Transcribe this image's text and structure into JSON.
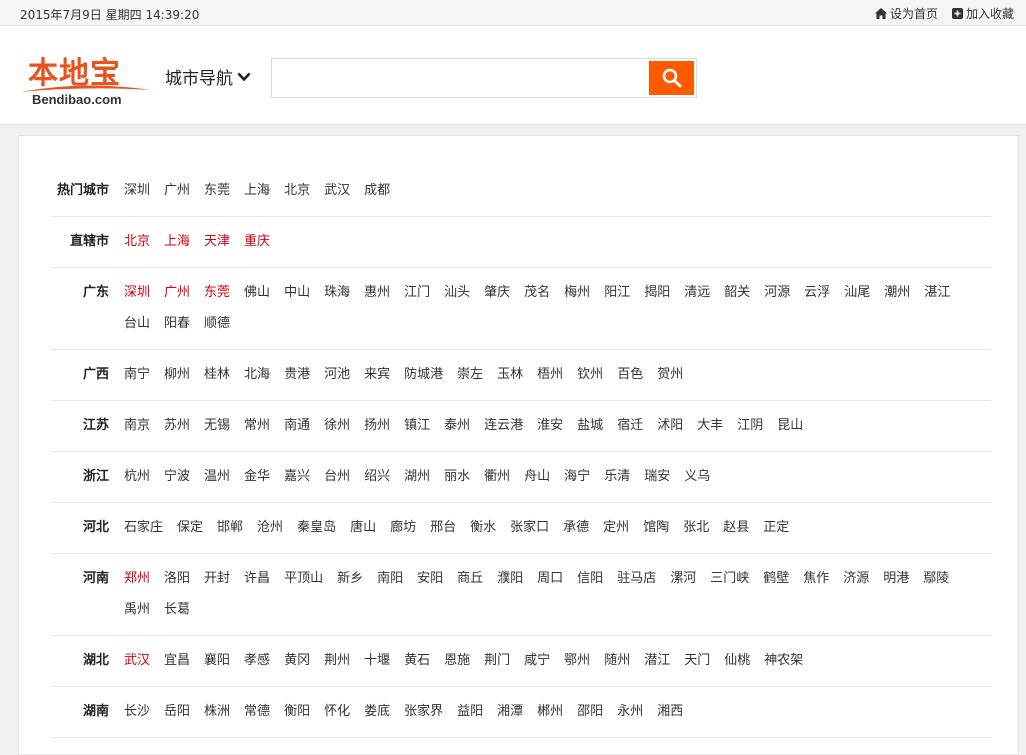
{
  "topbar": {
    "date": "2015年7月9日 星期四 14:39:20",
    "set_home": "设为首页",
    "add_fav": "加入收藏"
  },
  "header": {
    "logo_cn": "本地宝",
    "logo_en": "Bendibao.com",
    "city_nav": "城市导航",
    "search_placeholder": "",
    "colors": {
      "accent": "#ff5a00",
      "highlight": "#d7000f"
    }
  },
  "rows": [
    {
      "label": "热门城市",
      "cities": [
        {
          "n": "深圳"
        },
        {
          "n": "广州"
        },
        {
          "n": "东莞"
        },
        {
          "n": "上海"
        },
        {
          "n": "北京"
        },
        {
          "n": "武汉"
        },
        {
          "n": "成都"
        }
      ]
    },
    {
      "label": "直辖市",
      "cities": [
        {
          "n": "北京",
          "hot": true
        },
        {
          "n": "上海",
          "hot": true
        },
        {
          "n": "天津",
          "hot": true
        },
        {
          "n": "重庆",
          "hot": true
        }
      ]
    },
    {
      "label": "广东",
      "cities": [
        {
          "n": "深圳",
          "hot": true
        },
        {
          "n": "广州",
          "hot": true
        },
        {
          "n": "东莞",
          "hot": true
        },
        {
          "n": "佛山"
        },
        {
          "n": "中山"
        },
        {
          "n": "珠海"
        },
        {
          "n": "惠州"
        },
        {
          "n": "江门"
        },
        {
          "n": "汕头"
        },
        {
          "n": "肇庆"
        },
        {
          "n": "茂名"
        },
        {
          "n": "梅州"
        },
        {
          "n": "阳江"
        },
        {
          "n": "揭阳"
        },
        {
          "n": "清远"
        },
        {
          "n": "韶关"
        },
        {
          "n": "河源"
        },
        {
          "n": "云浮"
        },
        {
          "n": "汕尾"
        },
        {
          "n": "潮州"
        },
        {
          "n": "湛江"
        },
        {
          "n": "台山"
        },
        {
          "n": "阳春"
        },
        {
          "n": "顺德"
        }
      ]
    },
    {
      "label": "广西",
      "cities": [
        {
          "n": "南宁"
        },
        {
          "n": "柳州"
        },
        {
          "n": "桂林"
        },
        {
          "n": "北海"
        },
        {
          "n": "贵港"
        },
        {
          "n": "河池"
        },
        {
          "n": "来宾"
        },
        {
          "n": "防城港"
        },
        {
          "n": "崇左"
        },
        {
          "n": "玉林"
        },
        {
          "n": "梧州"
        },
        {
          "n": "钦州"
        },
        {
          "n": "百色"
        },
        {
          "n": "贺州"
        }
      ]
    },
    {
      "label": "江苏",
      "cities": [
        {
          "n": "南京"
        },
        {
          "n": "苏州"
        },
        {
          "n": "无锡"
        },
        {
          "n": "常州"
        },
        {
          "n": "南通"
        },
        {
          "n": "徐州"
        },
        {
          "n": "扬州"
        },
        {
          "n": "镇江"
        },
        {
          "n": "泰州"
        },
        {
          "n": "连云港"
        },
        {
          "n": "淮安"
        },
        {
          "n": "盐城"
        },
        {
          "n": "宿迁"
        },
        {
          "n": "沭阳"
        },
        {
          "n": "大丰"
        },
        {
          "n": "江阴"
        },
        {
          "n": "昆山"
        }
      ]
    },
    {
      "label": "浙江",
      "cities": [
        {
          "n": "杭州"
        },
        {
          "n": "宁波"
        },
        {
          "n": "温州"
        },
        {
          "n": "金华"
        },
        {
          "n": "嘉兴"
        },
        {
          "n": "台州"
        },
        {
          "n": "绍兴"
        },
        {
          "n": "湖州"
        },
        {
          "n": "丽水"
        },
        {
          "n": "衢州"
        },
        {
          "n": "舟山"
        },
        {
          "n": "海宁"
        },
        {
          "n": "乐清"
        },
        {
          "n": "瑞安"
        },
        {
          "n": "义乌"
        }
      ]
    },
    {
      "label": "河北",
      "cities": [
        {
          "n": "石家庄"
        },
        {
          "n": "保定"
        },
        {
          "n": "邯郸"
        },
        {
          "n": "沧州"
        },
        {
          "n": "秦皇岛"
        },
        {
          "n": "唐山"
        },
        {
          "n": "廊坊"
        },
        {
          "n": "邢台"
        },
        {
          "n": "衡水"
        },
        {
          "n": "张家口"
        },
        {
          "n": "承德"
        },
        {
          "n": "定州"
        },
        {
          "n": "馆陶"
        },
        {
          "n": "张北"
        },
        {
          "n": "赵县"
        },
        {
          "n": "正定"
        }
      ]
    },
    {
      "label": "河南",
      "cities": [
        {
          "n": "郑州",
          "hot": true
        },
        {
          "n": "洛阳"
        },
        {
          "n": "开封"
        },
        {
          "n": "许昌"
        },
        {
          "n": "平顶山"
        },
        {
          "n": "新乡"
        },
        {
          "n": "南阳"
        },
        {
          "n": "安阳"
        },
        {
          "n": "商丘"
        },
        {
          "n": "濮阳"
        },
        {
          "n": "周口"
        },
        {
          "n": "信阳"
        },
        {
          "n": "驻马店"
        },
        {
          "n": "漯河"
        },
        {
          "n": "三门峡"
        },
        {
          "n": "鹤壁"
        },
        {
          "n": "焦作"
        },
        {
          "n": "济源"
        },
        {
          "n": "明港"
        },
        {
          "n": "鄢陵"
        },
        {
          "n": "禹州"
        },
        {
          "n": "长葛"
        }
      ]
    },
    {
      "label": "湖北",
      "cities": [
        {
          "n": "武汉",
          "hot": true
        },
        {
          "n": "宜昌"
        },
        {
          "n": "襄阳"
        },
        {
          "n": "孝感"
        },
        {
          "n": "黄冈"
        },
        {
          "n": "荆州"
        },
        {
          "n": "十堰"
        },
        {
          "n": "黄石"
        },
        {
          "n": "恩施"
        },
        {
          "n": "荆门"
        },
        {
          "n": "咸宁"
        },
        {
          "n": "鄂州"
        },
        {
          "n": "随州"
        },
        {
          "n": "潜江"
        },
        {
          "n": "天门"
        },
        {
          "n": "仙桃"
        },
        {
          "n": "神农架"
        }
      ]
    },
    {
      "label": "湖南",
      "cities": [
        {
          "n": "长沙"
        },
        {
          "n": "岳阳"
        },
        {
          "n": "株洲"
        },
        {
          "n": "常德"
        },
        {
          "n": "衡阳"
        },
        {
          "n": "怀化"
        },
        {
          "n": "娄底"
        },
        {
          "n": "张家界"
        },
        {
          "n": "益阳"
        },
        {
          "n": "湘潭"
        },
        {
          "n": "郴州"
        },
        {
          "n": "邵阳"
        },
        {
          "n": "永州"
        },
        {
          "n": "湘西"
        }
      ]
    }
  ]
}
